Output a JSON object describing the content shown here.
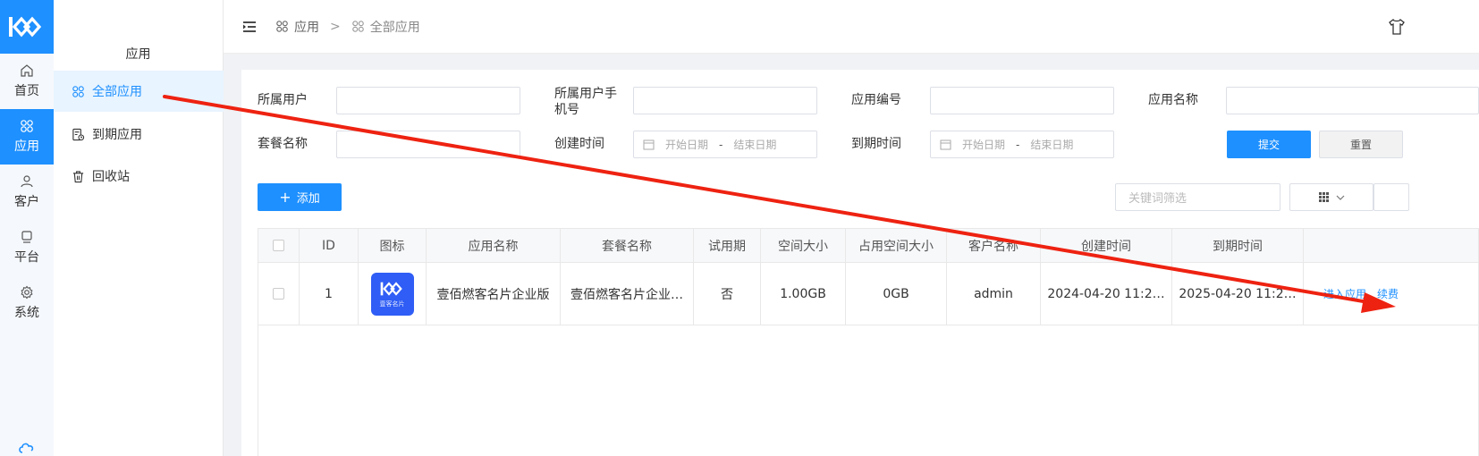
{
  "rail": {
    "items": [
      {
        "label": "首页",
        "icon": "home-icon"
      },
      {
        "label": "应用",
        "icon": "apps-icon",
        "active": true
      },
      {
        "label": "客户",
        "icon": "user-icon"
      },
      {
        "label": "平台",
        "icon": "monitor-icon"
      },
      {
        "label": "系统",
        "icon": "gear-icon"
      }
    ]
  },
  "submenu": {
    "title": "应用",
    "items": [
      {
        "label": "全部应用",
        "icon": "apps-icon",
        "active": true
      },
      {
        "label": "到期应用",
        "icon": "expire-icon"
      },
      {
        "label": "回收站",
        "icon": "trash-icon"
      }
    ]
  },
  "breadcrumb": {
    "level1": "应用",
    "separator": ">",
    "level2": "全部应用"
  },
  "filters": {
    "owner_label": "所属用户",
    "owner_phone_label": "所属用户手机号",
    "app_code_label": "应用编号",
    "app_name_label": "应用名称",
    "package_label": "套餐名称",
    "created_label": "创建时间",
    "expire_label": "到期时间",
    "start_placeholder": "开始日期",
    "end_placeholder": "结束日期",
    "range_sep": "-",
    "submit": "提交",
    "reset": "重置"
  },
  "toolbar": {
    "add": "添加",
    "add_icon": "+",
    "keyword_placeholder": "关键词筛选"
  },
  "table": {
    "headers": [
      "ID",
      "图标",
      "应用名称",
      "套餐名称",
      "试用期",
      "空间大小",
      "占用空间大小",
      "客户名称",
      "创建时间",
      "到期时间"
    ],
    "rows": [
      {
        "id": "1",
        "icon_caption": "壹客名片",
        "app_name": "壹佰燃客名片企业版",
        "package": "壹佰燃客名片企业…",
        "trial": "否",
        "space": "1.00GB",
        "used": "0GB",
        "customer": "admin",
        "created": "2024-04-20 11:2…",
        "expire": "2025-04-20 11:2…",
        "actions": [
          "进入应用",
          "续费"
        ]
      }
    ]
  },
  "colors": {
    "primary": "#1e90ff",
    "annotation": "#ee2211"
  }
}
